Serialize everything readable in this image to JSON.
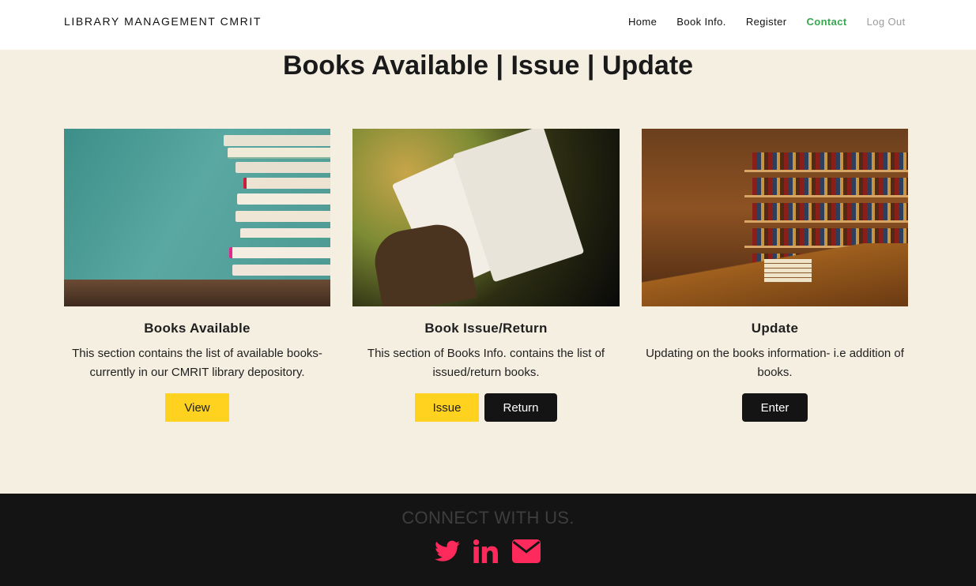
{
  "brand": "LIBRARY MANAGEMENT CMRIT",
  "nav": [
    {
      "label": "Home"
    },
    {
      "label": "Book Info."
    },
    {
      "label": "Register"
    },
    {
      "label": "Contact"
    },
    {
      "label": "Log Out"
    }
  ],
  "heading": "Books Available | Issue | Update",
  "cards": [
    {
      "title": "Books Available",
      "text": "This section contains the list of available books-currently in our CMRIT library depository.",
      "buttons": [
        "View"
      ]
    },
    {
      "title": "Book Issue/Return",
      "text": "This section of Books Info. contains the list of issued/return books.",
      "buttons": [
        "Issue",
        "Return"
      ]
    },
    {
      "title": "Update",
      "text": "Updating on the books information- i.e addition of books.",
      "buttons": [
        "Enter"
      ]
    }
  ],
  "footer": {
    "connect": "CONNECT WITH US.",
    "icons": [
      "twitter-icon",
      "linkedin-icon",
      "email-icon"
    ]
  },
  "colors": {
    "accent_green": "#3aa651",
    "button_yellow": "#ffd21f",
    "button_dark": "#141414",
    "page_bg": "#f5efe2",
    "social_pink": "#ff2a5c"
  }
}
